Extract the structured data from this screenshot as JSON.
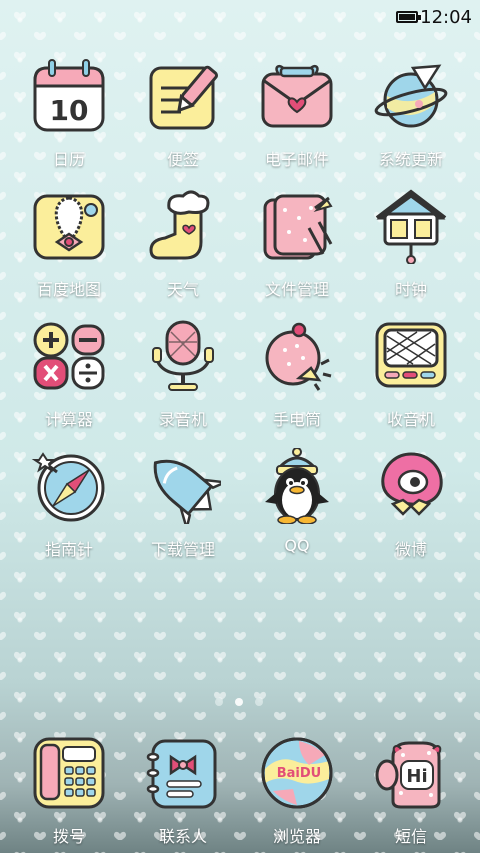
{
  "status_bar": {
    "time": "12:04"
  },
  "apps": [
    {
      "label": "日历",
      "icon": "calendar-icon",
      "day": "10"
    },
    {
      "label": "便签",
      "icon": "notepad-icon"
    },
    {
      "label": "电子邮件",
      "icon": "mail-icon"
    },
    {
      "label": "系统更新",
      "icon": "planet-icon"
    },
    {
      "label": "百度地图",
      "icon": "map-icon"
    },
    {
      "label": "天气",
      "icon": "boot-icon"
    },
    {
      "label": "文件管理",
      "icon": "folder-icon"
    },
    {
      "label": "时钟",
      "icon": "birdhouse-clock-icon"
    },
    {
      "label": "计算器",
      "icon": "calculator-icon"
    },
    {
      "label": "录音机",
      "icon": "microphone-icon"
    },
    {
      "label": "手电筒",
      "icon": "flashlight-icon"
    },
    {
      "label": "收音机",
      "icon": "radio-icon"
    },
    {
      "label": "指南针",
      "icon": "compass-icon"
    },
    {
      "label": "下载管理",
      "icon": "rocket-icon"
    },
    {
      "label": "QQ",
      "icon": "penguin-icon"
    },
    {
      "label": "微博",
      "icon": "weibo-icon"
    }
  ],
  "page_indicator": {
    "pages": 3,
    "current": 2
  },
  "dock": [
    {
      "label": "拨号",
      "icon": "phone-icon"
    },
    {
      "label": "联系人",
      "icon": "contacts-icon"
    },
    {
      "label": "浏览器",
      "icon": "browser-icon",
      "logo_text": "BaiDU"
    },
    {
      "label": "短信",
      "icon": "message-icon",
      "logo_text": "Hi"
    }
  ]
}
